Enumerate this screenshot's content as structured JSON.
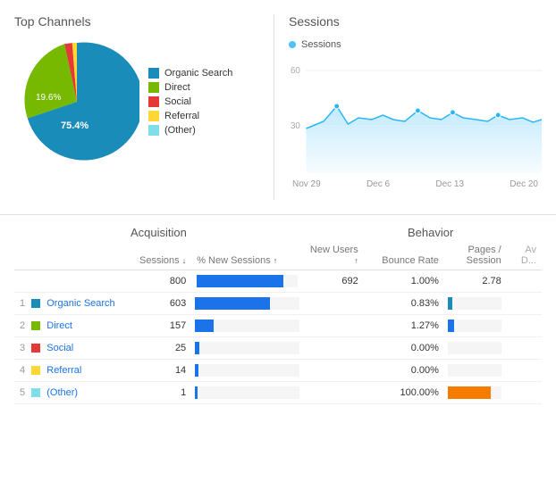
{
  "topChannels": {
    "title": "Top Channels",
    "legend": [
      {
        "label": "Organic Search",
        "color": "#1a8cba"
      },
      {
        "label": "Direct",
        "color": "#76b900"
      },
      {
        "label": "Social",
        "color": "#e53935"
      },
      {
        "label": "Referral",
        "color": "#fdd835"
      },
      {
        "label": "(Other)",
        "color": "#80deea"
      }
    ],
    "pieData": [
      {
        "label": "Organic Search",
        "value": 75.4,
        "color": "#1a8cba"
      },
      {
        "label": "Direct",
        "value": 19.6,
        "color": "#76b900"
      },
      {
        "label": "Social",
        "value": 2.5,
        "color": "#e53935"
      },
      {
        "label": "Referral",
        "value": 1.5,
        "color": "#fdd835"
      },
      {
        "label": "(Other)",
        "value": 1.0,
        "color": "#80deea"
      }
    ],
    "label75": "75.4%",
    "label19": "19.6%"
  },
  "sessions": {
    "title": "Sessions",
    "dotLabel": "Sessions",
    "yLabels": [
      "60",
      "30"
    ],
    "xLabels": [
      "Nov 29",
      "Dec 6",
      "Dec 13",
      "Dec 20"
    ]
  },
  "table": {
    "groupAcquisition": "Acquisition",
    "groupBehavior": "Behavior",
    "headers": {
      "sessions": "Sessions",
      "newSessions": "% New Sessions",
      "newUsers": "New Users",
      "bounceRate": "Bounce Rate",
      "pagesSession": "Pages / Session",
      "avgDuration": "Av D..."
    },
    "summary": {
      "sessions": "800",
      "newSessionsPct": "86.50%",
      "newUsers": "692",
      "bounceRate": "1.00%",
      "pagesSession": "2.78"
    },
    "rows": [
      {
        "num": "1",
        "channel": "Organic Search",
        "color": "#1a8cba",
        "sessions": "603",
        "newSessionsBarPct": 72,
        "newUsers": "",
        "bounceRate": "0.83%",
        "pagesBarPct": 8,
        "pagesBarColor": "#1a8cba"
      },
      {
        "num": "2",
        "channel": "Direct",
        "color": "#76b900",
        "sessions": "157",
        "newSessionsBarPct": 18,
        "newUsers": "",
        "bounceRate": "1.27%",
        "pagesBarPct": 12,
        "pagesBarColor": "#1a73e8"
      },
      {
        "num": "3",
        "channel": "Social",
        "color": "#e53935",
        "sessions": "25",
        "newSessionsBarPct": 4,
        "newUsers": "",
        "bounceRate": "0.00%",
        "pagesBarPct": 0,
        "pagesBarColor": "#1a73e8"
      },
      {
        "num": "4",
        "channel": "Referral",
        "color": "#fdd835",
        "sessions": "14",
        "newSessionsBarPct": 3,
        "newUsers": "",
        "bounceRate": "0.00%",
        "pagesBarPct": 0,
        "pagesBarColor": "#1a73e8"
      },
      {
        "num": "5",
        "channel": "(Other)",
        "color": "#80deea",
        "sessions": "1",
        "newSessionsBarPct": 2,
        "newUsers": "",
        "bounceRate": "100.00%",
        "pagesBarPct": 80,
        "pagesBarColor": "#f57c00"
      }
    ]
  }
}
